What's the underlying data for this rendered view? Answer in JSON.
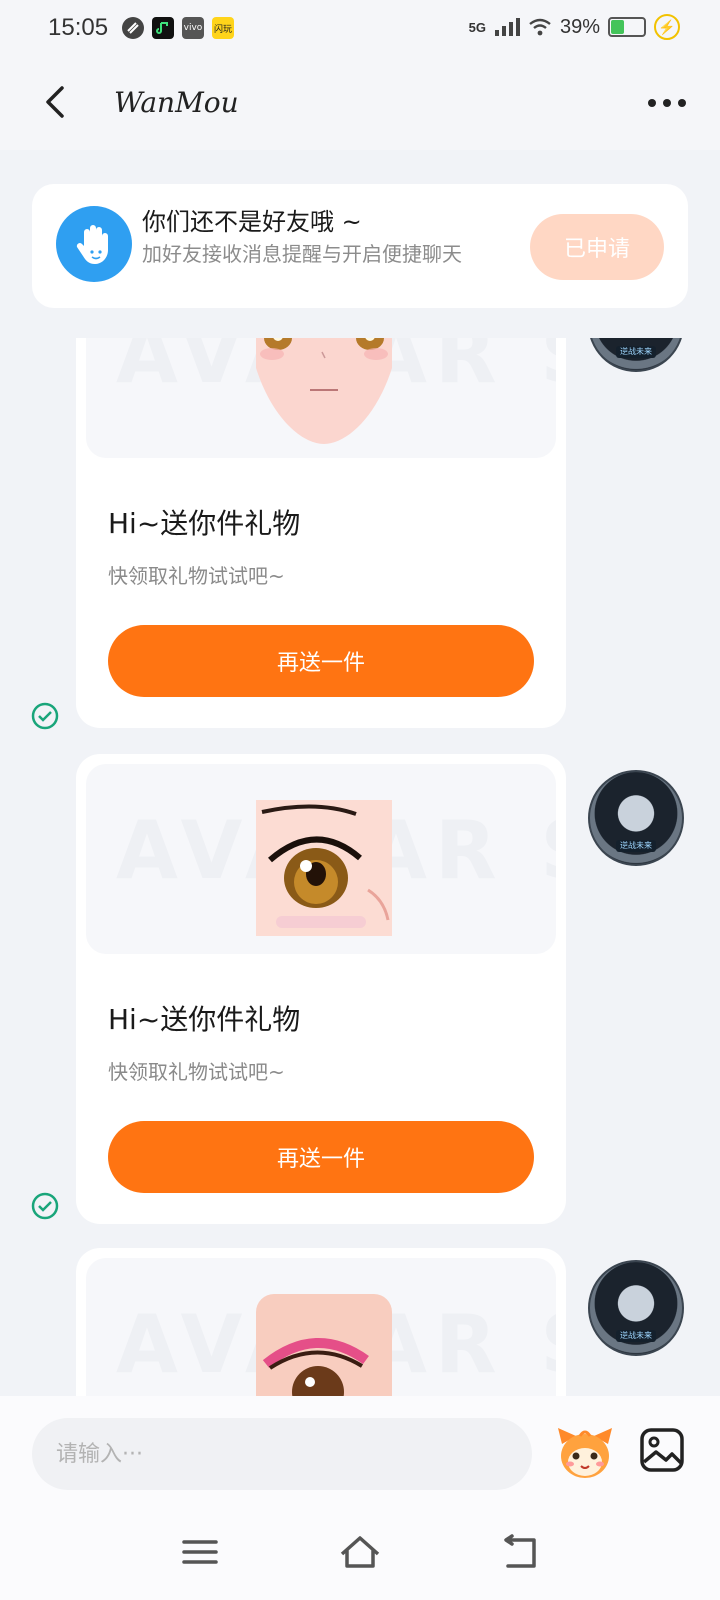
{
  "status_bar": {
    "time": "15:05",
    "network": "5G",
    "battery": "39%",
    "battery_level": 0.39,
    "app_icons": [
      "link-app-icon",
      "music-app-icon",
      "vivo-app-icon",
      "shanwan-app-icon"
    ],
    "shanwan_label": "闪玩",
    "vivo_label": "vivo"
  },
  "header": {
    "title": "WanMou"
  },
  "banner": {
    "title": "你们还不是好友哦 ~",
    "subtitle": "加好友接收消息提醒与开启便捷聊天",
    "button": "已申请"
  },
  "messages": [
    {
      "watermark": "AVATAR STORE",
      "title": "Hi~送你件礼物",
      "subtitle": "快领取礼物试试吧~",
      "button": "再送一件",
      "avatar_tag": "逆战未来",
      "status": "sent"
    },
    {
      "watermark": "AVATAR STORE",
      "title": "Hi~送你件礼物",
      "subtitle": "快领取礼物试试吧~",
      "button": "再送一件",
      "avatar_tag": "逆战未来",
      "status": "sent"
    },
    {
      "watermark": "AVATAR STORE",
      "avatar_tag": "逆战未来"
    }
  ],
  "input": {
    "placeholder": "请输入···"
  },
  "colors": {
    "accent": "#ff7412",
    "applied_button": "#ffd7c4",
    "check": "#19a57a",
    "hand_icon": "#2f9ff1"
  }
}
